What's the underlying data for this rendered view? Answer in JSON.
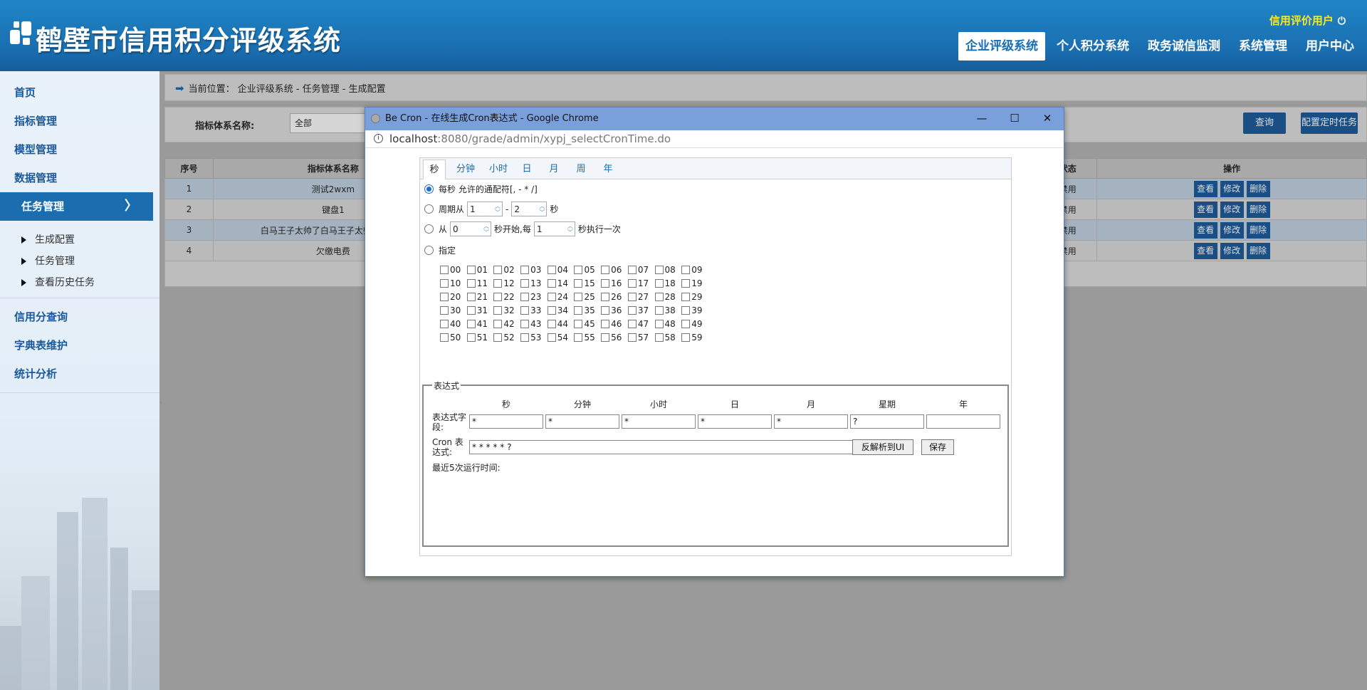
{
  "header": {
    "title": "鹤壁市信用积分评级系统",
    "user_link": "信用评价用户",
    "nav": [
      "企业评级系统",
      "个人积分系统",
      "政务诚信监测",
      "系统管理",
      "用户中心"
    ],
    "active_nav": 0
  },
  "sidebar": {
    "items_top": [
      "首页",
      "指标管理",
      "模型管理",
      "数据管理"
    ],
    "active_item": "任务管理",
    "sub_items": [
      "生成配置",
      "任务管理",
      "查看历史任务"
    ],
    "items_bottom": [
      "信用分查询",
      "字典表维护",
      "统计分析"
    ]
  },
  "breadcrumb": "当前位置： 企业评级系统 - 任务管理 - 生成配置",
  "filter": {
    "label": "指标体系名称:",
    "select_value": "全部",
    "query_button": "查询",
    "config_button": "配置定时任务"
  },
  "table": {
    "headers": {
      "index": "序号",
      "name": "指标体系名称",
      "status": "状态",
      "ops": "操作"
    },
    "rows": [
      {
        "index": "1",
        "name": "测试2wxm",
        "status": "禁用"
      },
      {
        "index": "2",
        "name": "键盘1",
        "status": "禁用"
      },
      {
        "index": "3",
        "name": "白马王子太帅了白马王子太帅了白马王",
        "status": "禁用"
      },
      {
        "index": "4",
        "name": "欠缴电费",
        "status": "禁用"
      }
    ],
    "ops": [
      "查看",
      "修改",
      "删除"
    ]
  },
  "popup": {
    "window_title": "Be Cron - 在线生成Cron表达式 - Google Chrome",
    "url_host": "localhost",
    "url_path": ":8080/grade/admin/xypj_selectCronTime.do",
    "tabs": [
      "秒",
      "分钟",
      "小时",
      "日",
      "月",
      "周",
      "年"
    ],
    "active_tab": 0,
    "option_every": "每秒 允许的通配符[, - * /]",
    "option_cycle_prefix": "周期从",
    "cycle_from": "1",
    "cycle_sep": "-",
    "cycle_to": "2",
    "cycle_suffix": "秒",
    "option_from_prefix": "从",
    "from_start": "0",
    "from_mid": "秒开始,每",
    "from_every": "1",
    "from_suffix": "秒执行一次",
    "option_specify": "指定",
    "checkbox_rows": [
      [
        "00",
        "01",
        "02",
        "03",
        "04",
        "05",
        "06",
        "07",
        "08",
        "09"
      ],
      [
        "10",
        "11",
        "12",
        "13",
        "14",
        "15",
        "16",
        "17",
        "18",
        "19"
      ],
      [
        "20",
        "21",
        "22",
        "23",
        "24",
        "25",
        "26",
        "27",
        "28",
        "29"
      ],
      [
        "30",
        "31",
        "32",
        "33",
        "34",
        "35",
        "36",
        "37",
        "38",
        "39"
      ],
      [
        "40",
        "41",
        "42",
        "43",
        "44",
        "45",
        "46",
        "47",
        "48",
        "49"
      ],
      [
        "50",
        "51",
        "52",
        "53",
        "54",
        "55",
        "56",
        "57",
        "58",
        "59"
      ]
    ],
    "expression": {
      "legend": "表达式",
      "columns": [
        "秒",
        "分钟",
        "小时",
        "日",
        "月",
        "星期",
        "年"
      ],
      "field_label": "表达式字段:",
      "field_values": [
        "*",
        "*",
        "*",
        "*",
        "*",
        "?",
        ""
      ],
      "cron_label": "Cron 表达式:",
      "cron_value": "* * * * * ?",
      "parse_button": "反解析到UI",
      "save_button": "保存",
      "recent_label": "最近5次运行时间:"
    }
  }
}
